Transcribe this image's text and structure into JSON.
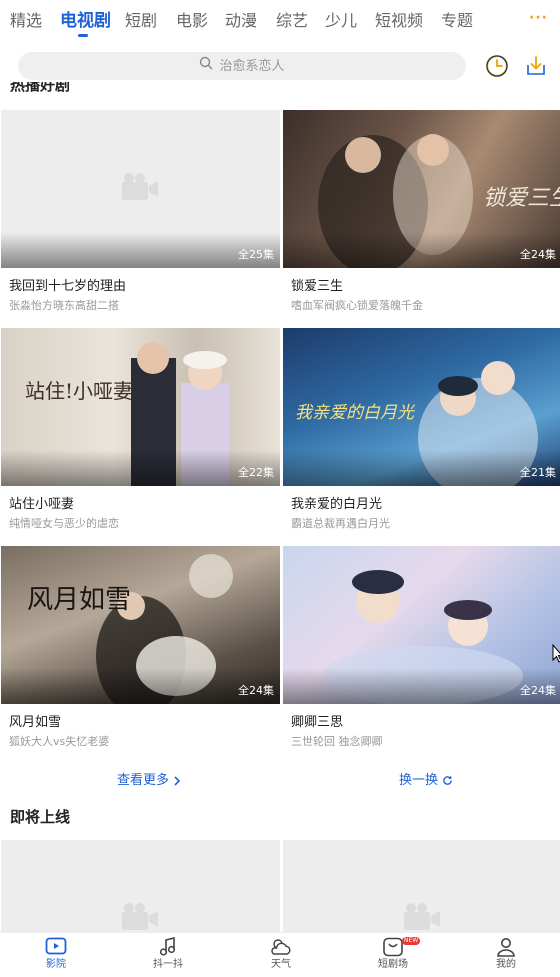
{
  "tabs": [
    {
      "label": "精选"
    },
    {
      "label": "电视剧"
    },
    {
      "label": "短剧"
    },
    {
      "label": "电影"
    },
    {
      "label": "动漫"
    },
    {
      "label": "综艺"
    },
    {
      "label": "少儿"
    },
    {
      "label": "短视频"
    },
    {
      "label": "专题"
    }
  ],
  "active_tab": "电视剧",
  "more_label": "···",
  "search": {
    "placeholder": "治愈系恋人"
  },
  "toolbar": {
    "history_icon": "history-clock-icon",
    "download_icon": "download-icon"
  },
  "cards": [
    {
      "title": "我回到十七岁的理由",
      "subtitle": "张淼怡方晓东高甜二搭",
      "episodes": "全25集",
      "poster": "placeholder"
    },
    {
      "title": "锁爱三生",
      "subtitle": "嗜血军阀疯心锁爱落魄千金",
      "episodes": "全24集",
      "poster": "lock",
      "poster_text": "锁爱三生"
    },
    {
      "title": "站住小哑妻",
      "subtitle": "纯情哑女与恶少的虐恋",
      "episodes": "全22集",
      "poster": "zhan",
      "poster_text": "站住!小哑妻"
    },
    {
      "title": "我亲爱的白月光",
      "subtitle": "霸道总裁再遇白月光",
      "episodes": "全21集",
      "poster": "moon",
      "poster_text": "我亲爱的白月光"
    },
    {
      "title": "风月如雪",
      "subtitle": "狐妖大人vs失忆老婆",
      "episodes": "全24集",
      "poster": "feng",
      "poster_text": "风月如雪"
    },
    {
      "title": "卿卿三思",
      "subtitle": "三世轮回 独念卿卿",
      "episodes": "全24集",
      "poster": "qing"
    }
  ],
  "actions": {
    "more": "查看更多",
    "refresh": "换一换"
  },
  "upcoming_section": {
    "title": "即将上线"
  },
  "bottom_nav": [
    {
      "label": "影院",
      "icon": "play-screen-icon",
      "active": true
    },
    {
      "label": "抖一抖",
      "icon": "music-note-icon"
    },
    {
      "label": "天气",
      "icon": "weather-cloud-icon"
    },
    {
      "label": "短剧场",
      "icon": "short-drama-icon",
      "badge": "NEW"
    },
    {
      "label": "我的",
      "icon": "user-icon"
    }
  ],
  "colors": {
    "accent": "#1e63d6",
    "badge": "#e53935",
    "more_dots": "#f0a020"
  }
}
